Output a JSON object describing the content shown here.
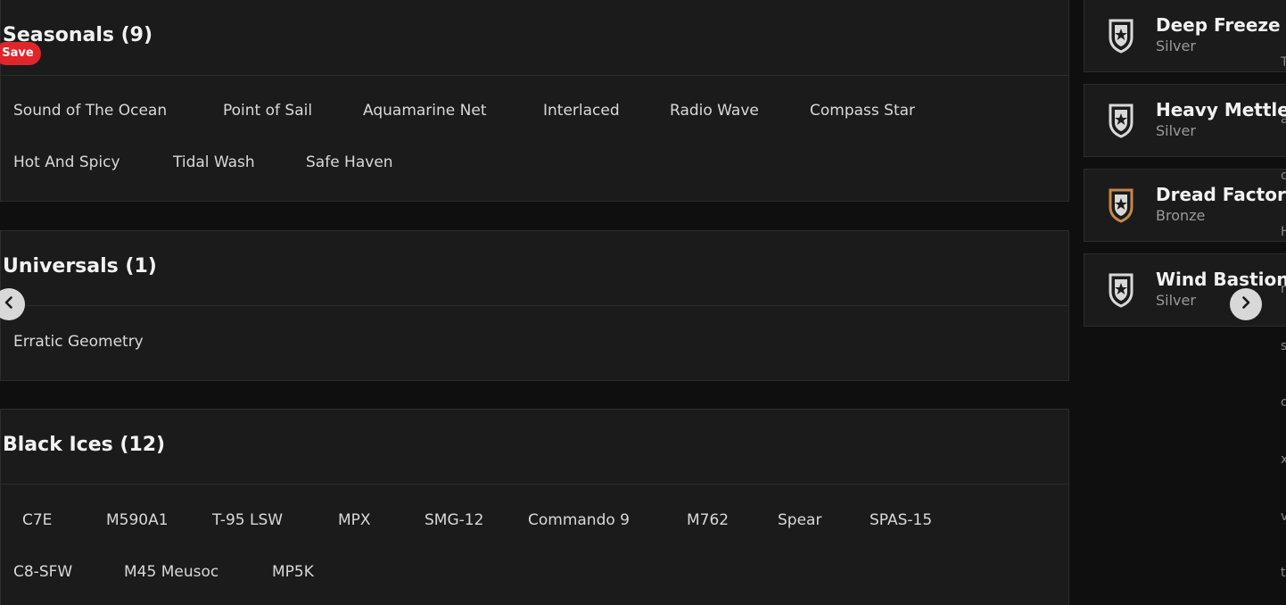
{
  "sections": {
    "seasonals": {
      "title": "Seasonals (9)",
      "row1": [
        "Sound of The Ocean",
        "Point of Sail",
        "Aquamarine Net",
        "Interlaced",
        "Radio Wave",
        "Compass Star"
      ],
      "row2": [
        "Hot And Spicy",
        "Tidal Wash",
        "Safe Haven"
      ]
    },
    "universals": {
      "title": "Universals (1)",
      "row1": [
        "Erratic Geometry"
      ]
    },
    "black_ices": {
      "title": "Black Ices (12)",
      "row1": [
        "C7E",
        "M590A1",
        "T-95 LSW",
        "MPX",
        "SMG-12",
        "Commando 9",
        "M762",
        "Spear",
        "SPAS-15"
      ],
      "row2": [
        "C8-SFW",
        "M45 Meusoc",
        "MP5K"
      ]
    }
  },
  "save_badge": "Save",
  "charms": [
    {
      "name": "Deep Freeze",
      "tier": "Silver"
    },
    {
      "name": "Heavy Mettle",
      "tier": "Silver"
    },
    {
      "name": "Dread Factor",
      "tier": "Bronze"
    },
    {
      "name": "Wind Bastion",
      "tier": "Silver"
    }
  ],
  "edge_letters": [
    "T",
    "a",
    "c",
    "H",
    "n",
    "s",
    "c",
    "x",
    "v",
    "t"
  ],
  "colors": {
    "background": "#0f0f0f",
    "card": "#1b1b1b",
    "save_badge": "#e0252b",
    "silver": "#d8d8d8",
    "bronze": "#c8864a"
  },
  "icons": {
    "carousel_prev": "chevron-left-icon",
    "carousel_next": "chevron-right-icon",
    "charm": "charm-shield-icon"
  }
}
